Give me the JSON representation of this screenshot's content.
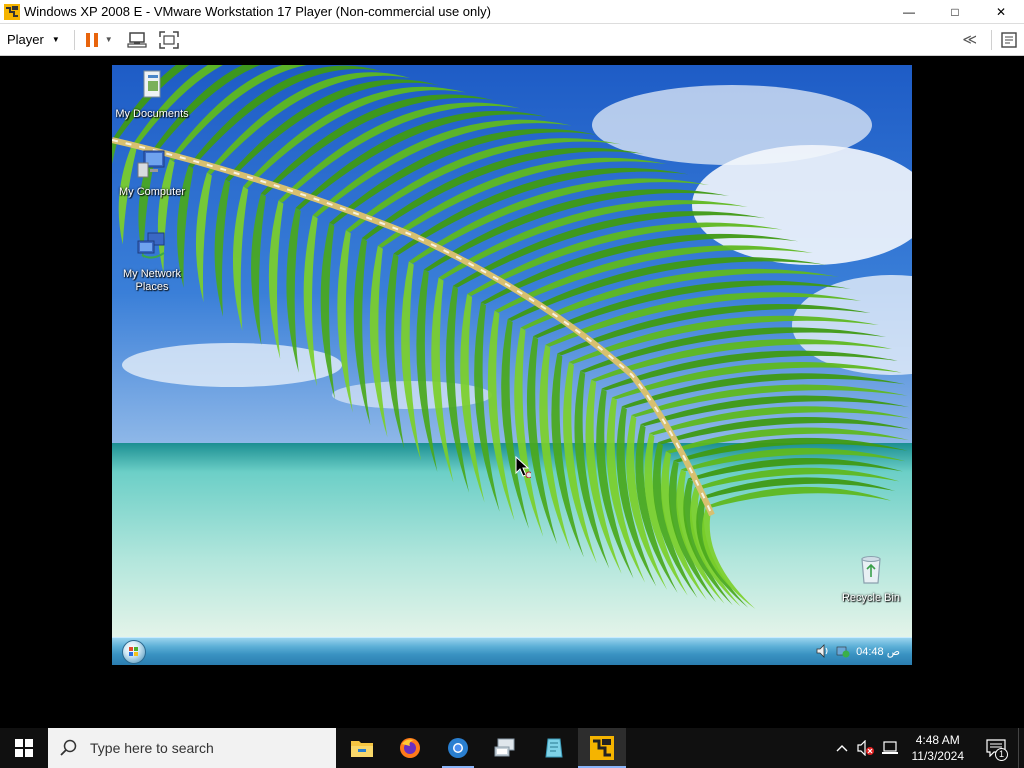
{
  "window": {
    "title": "Windows XP 2008 E - VMware Workstation 17 Player (Non-commercial use only)",
    "minimize": "—",
    "maximize": "□",
    "close": "✕"
  },
  "toolbar": {
    "player_menu": "Player",
    "player_caret": "▼",
    "pause_caret": "▼",
    "unity_label": "≪"
  },
  "guest": {
    "desktop_icons": [
      {
        "label": "My Documents",
        "icon": "my-documents-icon"
      },
      {
        "label": "My Computer",
        "icon": "my-computer-icon"
      },
      {
        "label": "My Network\nPlaces",
        "icon": "network-places-icon"
      },
      {
        "label": "Recycle Bin",
        "icon": "recycle-bin-icon"
      }
    ],
    "tray_time": "04:48 ص"
  },
  "host_taskbar": {
    "search_placeholder": "Type here to search",
    "apps": [
      "file-explorer-icon",
      "firefox-icon",
      "chrome-icon",
      "remote-desktop-icon",
      "notepad-icon",
      "vmware-icon"
    ],
    "clock_time": "4:48 AM",
    "clock_date": "11/3/2024",
    "notification_count": "1"
  },
  "colors": {
    "sky": "#2f6fd0",
    "sea": "#8fd6cf",
    "palm": "#4aa81c",
    "xp_taskbar": "#3a93c2",
    "host_taskbar": "#101010"
  }
}
